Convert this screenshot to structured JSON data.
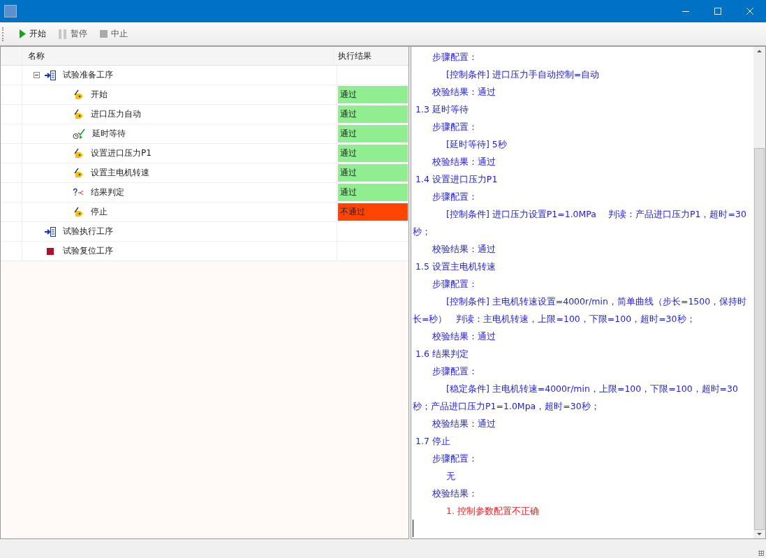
{
  "toolbar": [
    {
      "kind": "start",
      "label": "开始",
      "disabled": false
    },
    {
      "kind": "pause",
      "label": "暂停",
      "disabled": true
    },
    {
      "kind": "stop",
      "label": "中止",
      "disabled": true
    }
  ],
  "tree": {
    "columns": [
      "名称",
      "执行结果"
    ],
    "nodes": [
      {
        "kind": "sequence",
        "name": "试验准备工序",
        "expanded": true,
        "children": [
          {
            "kind": "action",
            "name": "开始",
            "result": "通过",
            "passed": true
          },
          {
            "kind": "action",
            "name": "进口压力自动",
            "result": "通过",
            "passed": true
          },
          {
            "kind": "timer",
            "name": "延时等待",
            "result": "通过",
            "passed": true
          },
          {
            "kind": "action",
            "name": "设置进口压力P1",
            "result": "通过",
            "passed": true
          },
          {
            "kind": "action",
            "name": "设置主电机转速",
            "result": "通过",
            "passed": true
          },
          {
            "kind": "decision",
            "name": "结果判定",
            "result": "通过",
            "passed": true
          },
          {
            "kind": "action",
            "name": "停止",
            "result": "不通过",
            "passed": false
          }
        ]
      },
      {
        "kind": "sequence",
        "name": "试验执行工序"
      },
      {
        "kind": "halt",
        "name": "试验复位工序"
      }
    ]
  },
  "log": [
    {
      "kind": "label",
      "text": "步骤配置："
    },
    {
      "kind": "detail",
      "text": "[控制条件] 进口压力手自动控制=自动"
    },
    {
      "kind": "label",
      "text": "校验结果：通过"
    },
    {
      "kind": "heading",
      "text": "1.3 延时等待"
    },
    {
      "kind": "label",
      "text": "步骤配置："
    },
    {
      "kind": "detail",
      "text": "[延时等待] 5秒"
    },
    {
      "kind": "label",
      "text": "校验结果：通过"
    },
    {
      "kind": "heading",
      "text": "1.4 设置进口压力P1"
    },
    {
      "kind": "label",
      "text": "步骤配置："
    },
    {
      "kind": "detail",
      "text": "[控制条件] 进口压力设置P1=1.0MPa　 判读：产品进口压力P1，超时=30秒；"
    },
    {
      "kind": "label",
      "text": "校验结果：通过"
    },
    {
      "kind": "heading",
      "text": "1.5 设置主电机转速"
    },
    {
      "kind": "label",
      "text": "步骤配置："
    },
    {
      "kind": "detail",
      "text": "[控制条件] 主电机转速设置=4000r/min，简单曲线（步长=1500，保持时长=秒）　判读：主电机转速，上限=100，下限=100，超时=30秒；"
    },
    {
      "kind": "label",
      "text": "校验结果：通过"
    },
    {
      "kind": "heading",
      "text": "1.6 结果判定"
    },
    {
      "kind": "label",
      "text": "步骤配置："
    },
    {
      "kind": "detail",
      "text": "[稳定条件] 主电机转速=4000r/min，上限=100，下限=100，超时=30秒；产品进口压力P1=1.0Mpa，超时=30秒；"
    },
    {
      "kind": "label",
      "text": "校验结果：通过"
    },
    {
      "kind": "heading",
      "text": "1.7 停止"
    },
    {
      "kind": "label",
      "text": "步骤配置："
    },
    {
      "kind": "detail",
      "text": "无"
    },
    {
      "kind": "label",
      "text": "校验结果："
    },
    {
      "kind": "error",
      "text": "1. 控制参数配置不正确"
    }
  ]
}
